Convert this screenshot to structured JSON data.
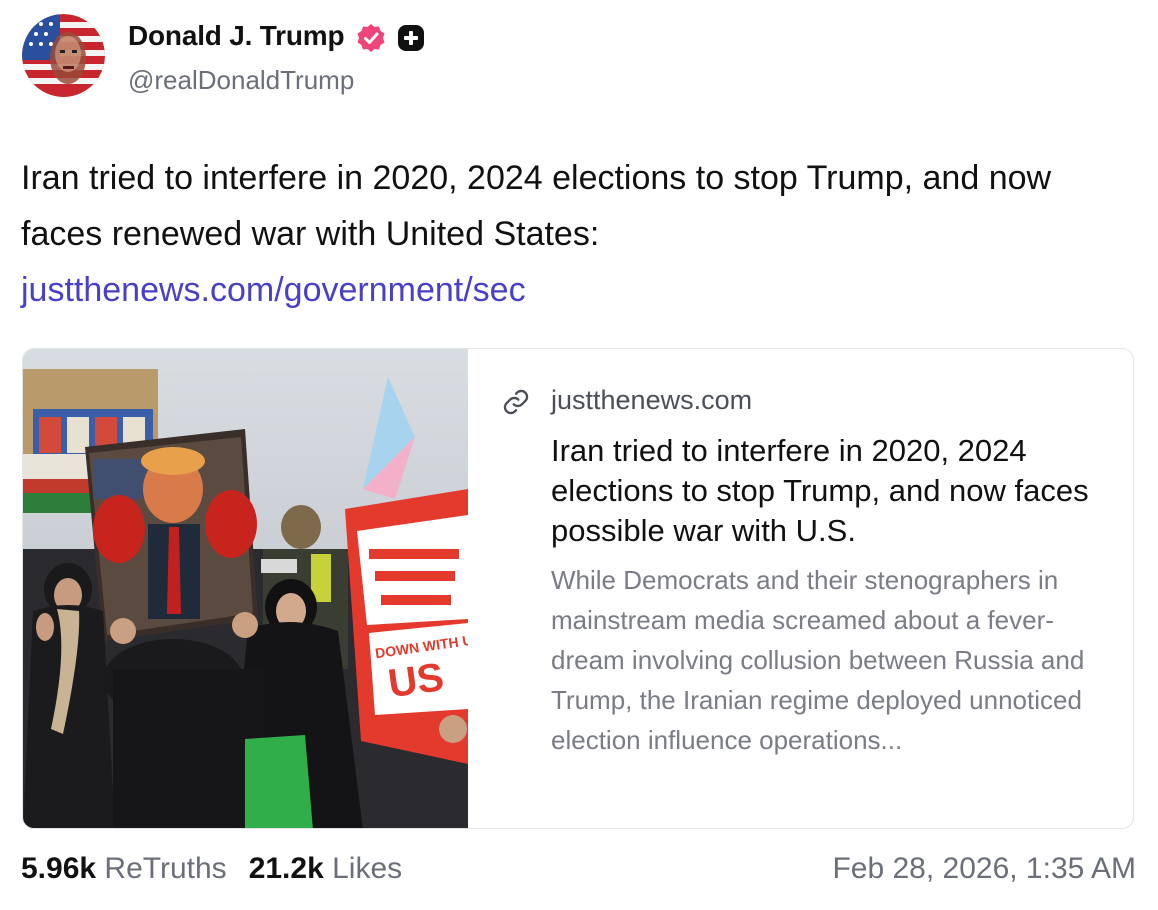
{
  "author": {
    "display_name": "Donald J. Trump",
    "handle": "@realDonaldTrump",
    "verified_icon": "verified-badge-icon",
    "plus_icon": "plus-badge-icon",
    "badge_color": "#f0457a"
  },
  "post": {
    "text": "Iran tried to interfere in 2020, 2024 elections to stop Trump, and now faces renewed war with United States:",
    "link_text": "justthenews.com/government/sec",
    "link_color": "#4a40c8"
  },
  "card": {
    "link_icon": "link-icon",
    "domain": "justthenews.com",
    "title": "Iran tried to interfere in 2020, 2024 elections to stop Trump, and now faces possible war with U.S.",
    "description": "While Democrats and their stenographers in mainstream media screamed about a fever-dream involving collusion between Russia and Trump, the Iranian regime deployed unnoticed election influence operations...",
    "image_sign_text": "DOWN WITH US"
  },
  "stats": {
    "retruths_count": "5.96k",
    "retruths_label": "ReTruths",
    "likes_count": "21.2k",
    "likes_label": "Likes",
    "timestamp": "Feb 28, 2026, 1:35 AM"
  }
}
